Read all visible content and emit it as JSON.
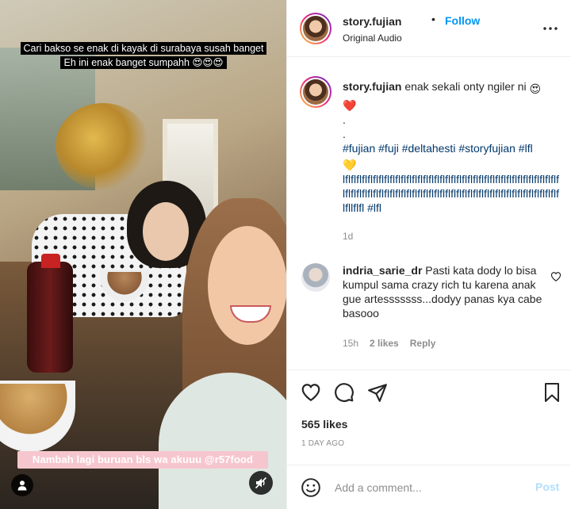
{
  "media": {
    "caption_top_line1": "Cari bakso se enak di kayak di surabaya susah banget",
    "caption_top_line2": "Eh ini enak banget sumpahh 😍😍😍",
    "caption_bottom": "Nambah lagi buruan bls wa akuuu @r57food",
    "user_icon": "user-icon",
    "mute_icon": "mute-icon"
  },
  "header": {
    "username": "story.fujian",
    "dot": "•",
    "follow_label": "Follow",
    "subtitle": "Original Audio",
    "more_icon": "more-horizontal-icon"
  },
  "caption": {
    "username": "story.fujian",
    "text": "enak sekali onty ngiler ni",
    "emoji1": "😍",
    "emoji2": "❤️",
    "dot1": ".",
    "dot2": ".",
    "hashtags": "#fujian #fuji #deltahesti #storyfujian #lfl",
    "emoji3": "💛",
    "tail": "lflflflflflflflflflflflflflflflflflflflflflflflflflflflflflflflflflflflflflflflflflflflflflflflflflflflflflflflflflflflflflflflflflflflflflflflflflflflflflflfllflfl #lfl",
    "time": "1d"
  },
  "comment": {
    "username": "indria_sarie_dr",
    "text": "Pasti kata dody lo bisa kumpul sama crazy rich tu karena anak gue artesssssss...dodyy panas kya cabe basooo",
    "time": "15h",
    "likes": "2 likes",
    "reply": "Reply"
  },
  "actions": {
    "like_icon": "heart-icon",
    "comment_icon": "comment-icon",
    "share_icon": "share-icon",
    "save_icon": "bookmark-icon"
  },
  "likes": "565 likes",
  "posted_ago": "1 DAY AGO",
  "add_comment": {
    "placeholder": "Add a comment...",
    "post_label": "Post"
  },
  "colors": {
    "accent": "#0095f6",
    "hashtag": "#00376b",
    "muted": "#8e8e8e",
    "post_disabled": "#b2dffc"
  }
}
